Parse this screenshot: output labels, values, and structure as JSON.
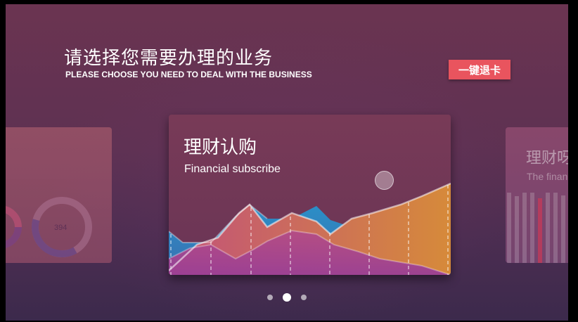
{
  "header": {
    "title_zh": "请选择您需要办理的业务",
    "title_en": "PLEASE CHOOSE YOU NEED TO DEAL WITH THE BUSINESS"
  },
  "eject_button": {
    "label": "一键退卡"
  },
  "cards": {
    "left": {
      "donut_value": "394"
    },
    "main": {
      "title": "理财认购",
      "subtitle": "Financial subscribe"
    },
    "right": {
      "title": "理财呀",
      "subtitle": "The finan"
    }
  },
  "pager": {
    "count": 3,
    "active_index": 1
  },
  "colors": {
    "eject_button": "#e9545e",
    "chart_blue": "#2f86bd",
    "chart_orange": "#d07a3f",
    "chart_magenta": "#a04590"
  }
}
